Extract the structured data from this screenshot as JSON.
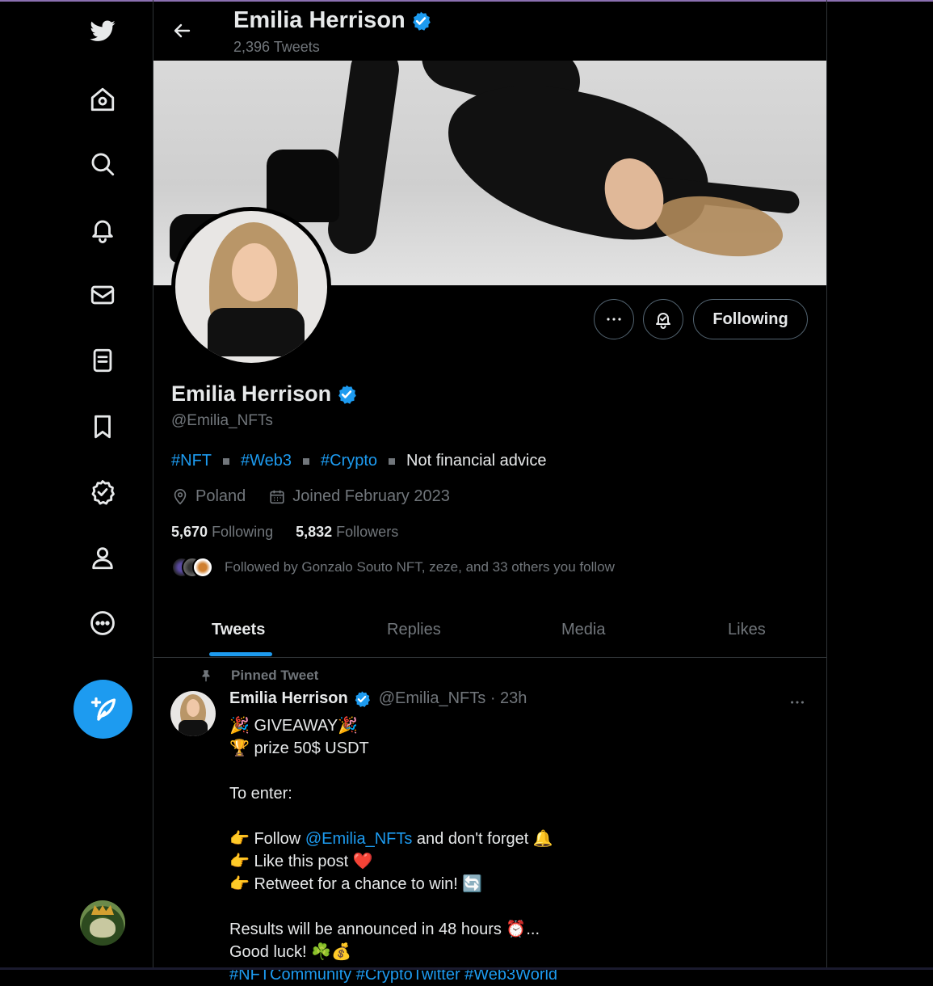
{
  "header": {
    "name": "Emilia Herrison",
    "tweet_count": "2,396 Tweets"
  },
  "profile": {
    "name": "Emilia Herrison",
    "handle": "@Emilia_NFTs",
    "bio": {
      "tags": [
        "#NFT",
        "#Web3",
        "#Crypto"
      ],
      "text": "Not financial advice"
    },
    "location": "Poland",
    "joined": "Joined February 2023",
    "following_count": "5,670",
    "following_label": "Following",
    "followers_count": "5,832",
    "followers_label": "Followers",
    "followed_by": "Followed by Gonzalo Souto NFT, zeze, and 33 others you follow",
    "following_button": "Following"
  },
  "tabs": [
    "Tweets",
    "Replies",
    "Media",
    "Likes"
  ],
  "tweet": {
    "pinned_label": "Pinned Tweet",
    "author": "Emilia Herrison",
    "handle_time": "@Emilia_NFTs · 23h",
    "lines": [
      "🎉 GIVEAWAY🎉",
      "🏆 prize 50$ USDT",
      "",
      "To enter:",
      "",
      "",
      "👉 Like this post ❤️",
      "👉 Retweet for a chance to win! 🔄",
      "",
      "Results will be announced in 48 hours ⏰...",
      " Good luck! ☘️💰"
    ],
    "follow_line": {
      "prefix": "👉 Follow ",
      "mention": "@Emilia_NFTs",
      "suffix": " and don't forget 🔔"
    },
    "cut_line": "#NFTCommunity #CryptoTwitter #Web3World"
  },
  "colors": {
    "accent": "#1d9bf0",
    "muted": "#71767b",
    "text": "#e7e9ea",
    "background": "#000000"
  },
  "icons": [
    "twitter-logo-icon",
    "home-icon",
    "search-icon",
    "bell-icon",
    "mail-icon",
    "lists-icon",
    "bookmark-icon",
    "verified-badge-icon",
    "profile-icon",
    "more-icon",
    "compose-icon"
  ]
}
